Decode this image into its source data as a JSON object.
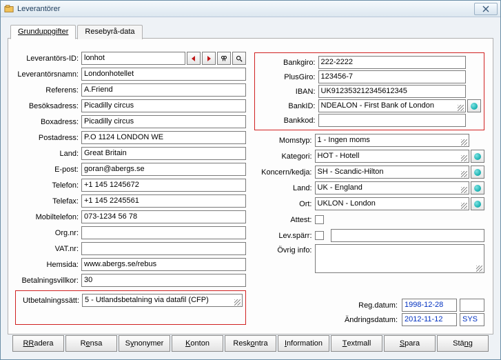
{
  "window": {
    "title": "Leverantörer"
  },
  "tabs": [
    {
      "label": "Grunduppgifter",
      "active": true
    },
    {
      "label": "Resebyrå-data",
      "active": false
    }
  ],
  "left": {
    "labels": {
      "lev_id": "Leverantörs-ID:",
      "lev_namn": "Leverantörsnamn:",
      "referens": "Referens:",
      "besok": "Besöksadress:",
      "box": "Boxadress:",
      "post": "Postadress:",
      "land": "Land:",
      "epost": "E-post:",
      "telefon": "Telefon:",
      "telefax": "Telefax:",
      "mobil": "Mobiltelefon:",
      "orgnr": "Org.nr:",
      "vat": "VAT.nr:",
      "hemsida": "Hemsida:",
      "betvillkor": "Betalningsvillkor:",
      "utbet": "Utbetalningssätt:"
    },
    "values": {
      "lev_id": "lonhot",
      "lev_namn": "Londonhotellet",
      "referens": "A.Friend",
      "besok": "Picadilly circus",
      "box": "Picadilly circus",
      "post": "P.O 1124 LONDON WE",
      "land": "Great Britain",
      "epost": "goran@abergs.se",
      "telefon": "+1 145 1245672",
      "telefax": "+1 145 2245561",
      "mobil": "073-1234 56 78",
      "orgnr": "",
      "vat": "",
      "hemsida": "www.abergs.se/rebus",
      "betvillkor": "30",
      "utbet": "5  - Utlandsbetalning via datafil (CFP)"
    }
  },
  "right": {
    "labels": {
      "bankgiro": "Bankgiro:",
      "plusgiro": "PlusGiro:",
      "iban": "IBAN:",
      "bankid": "BankID:",
      "bankkod": "Bankkod:",
      "momstyp": "Momstyp:",
      "kategori": "Kategori:",
      "koncern": "Koncern/kedja:",
      "land": "Land:",
      "ort": "Ort:",
      "attest": "Attest:",
      "levsparr": "Lev.spärr:",
      "ovrig": "Övrig info:",
      "regdatum": "Reg.datum:",
      "andring": "Ändringsdatum:"
    },
    "values": {
      "bankgiro": "222-2222",
      "plusgiro": "123456-7",
      "iban": "UK912353212345612345",
      "bankid": "NDEALON     - First Bank of London",
      "bankkod": "",
      "momstyp": "1  - Ingen moms",
      "kategori": "HOT           - Hotell",
      "koncern": "SH             - Scandic-Hilton",
      "land": "UK             - England",
      "ort": "UKLON      - London",
      "ovrig": "",
      "regdatum": "1998-12-28",
      "andring": "2012-11-12",
      "andring_user": "SYS"
    }
  },
  "buttons": {
    "radera": "Radera",
    "rensa": "Rensa",
    "synonymer": "Synonymer",
    "konton": "Konton",
    "reskontra": "Reskontra",
    "information": "Information",
    "textmall": "Textmall",
    "spara": "Spara",
    "stang": "Stäng"
  }
}
